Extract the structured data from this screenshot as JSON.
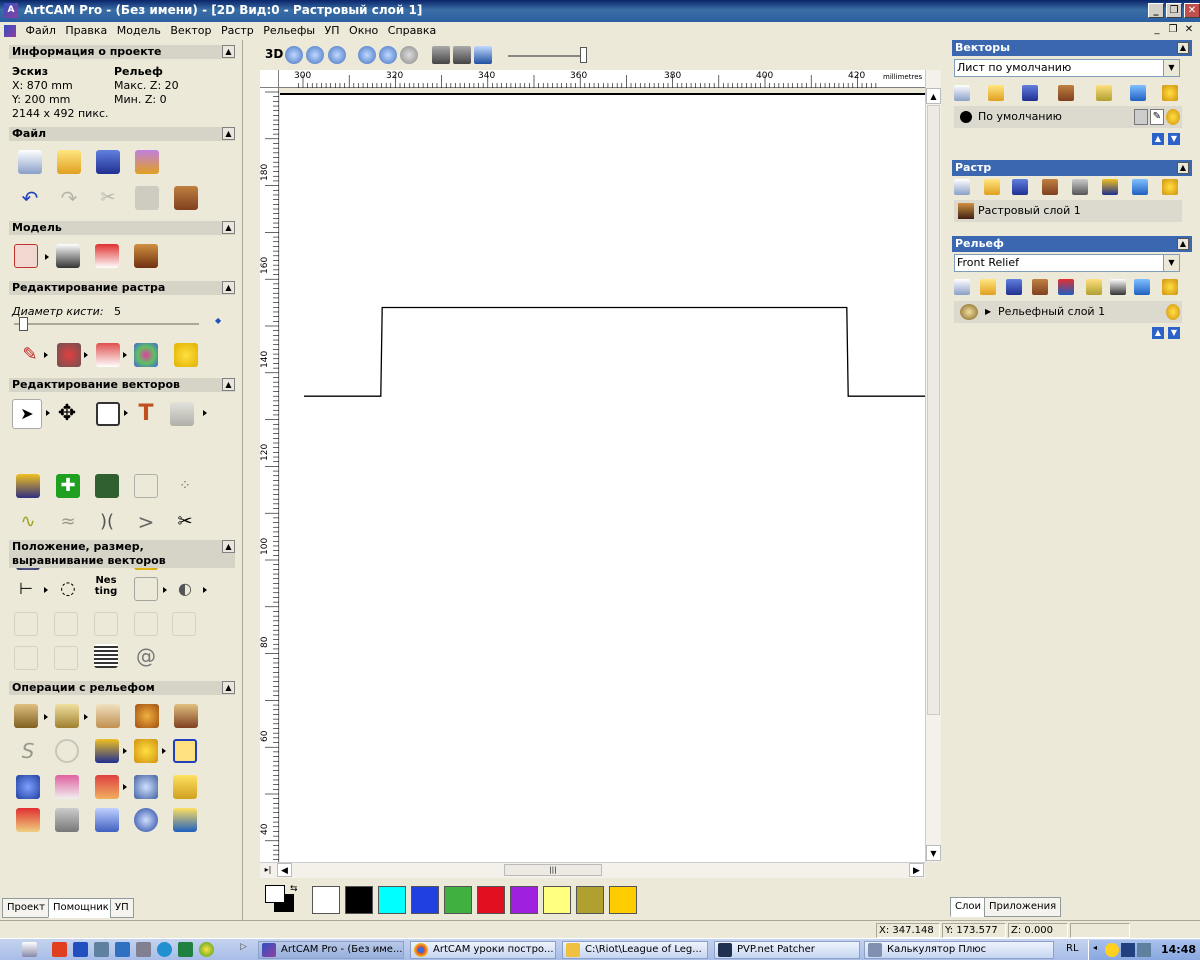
{
  "window": {
    "title": "ArtCAM Pro - (Без имени) - [2D Вид:0 - Растровый слой 1]"
  },
  "menu": [
    "Файл",
    "Правка",
    "Модель",
    "Вектор",
    "Растр",
    "Рельефы",
    "УП",
    "Окно",
    "Справка"
  ],
  "project_info": {
    "header": "Информация о проекте",
    "sketch_label": "Эскиз",
    "relief_label": "Рельеф",
    "x": "X: 870 mm",
    "y": "Y: 200 mm",
    "pixels": "2144 x 492 пикс.",
    "max_z": "Макс. Z: 20",
    "min_z": "Мин. Z: 0"
  },
  "sections": {
    "file": "Файл",
    "model": "Модель",
    "raster_edit": "Редактирование растра",
    "vector_edit": "Редактирование векторов",
    "position": "Положение, размер, выравнивание векторов",
    "relief_ops": "Операции с рельефом"
  },
  "brush": {
    "label": "Диаметр кисти:",
    "value": "5"
  },
  "view_toolbar": {
    "btn3d": "3D"
  },
  "ruler": {
    "h_ticks": [
      "300",
      "320",
      "340",
      "360",
      "380",
      "400",
      "420"
    ],
    "units": "millimetres",
    "v_ticks": [
      "180",
      "160",
      "140",
      "120",
      "100",
      "80",
      "60",
      "40"
    ]
  },
  "drawing": {
    "profile_y_low": 122,
    "profile_y_high": 141,
    "profile_x_start": 300,
    "profile_x_rise": 317,
    "profile_x_fall": 418,
    "profile_x_end": 436
  },
  "palette": {
    "colors": [
      "#ffffff",
      "#000000",
      "#00ffff",
      "#2040e0",
      "#40b040",
      "#e01020",
      "#a020e0",
      "#ffff80",
      "#b0a030",
      "#ffcc00"
    ]
  },
  "vectors_panel": {
    "header": "Векторы",
    "sheet": "Лист по умолчанию",
    "layer": "По умолчанию"
  },
  "raster_panel": {
    "header": "Растр",
    "layer": "Растровый слой 1"
  },
  "relief_panel": {
    "header": "Рельеф",
    "relief": "Front Relief",
    "layer": "Рельефный слой 1"
  },
  "left_tabs": [
    "Проект",
    "Помощник",
    "УП"
  ],
  "right_tabs": [
    "Слои",
    "Приложения"
  ],
  "status": {
    "x": "X: 347.148",
    "y": "Y: 173.577",
    "z": "Z: 0.000"
  },
  "taskbar": {
    "items": [
      "ArtCAM Pro - (Без име...",
      "ArtCAM уроки постро...",
      "C:\\Riot\\League of Leg...",
      "PVP.net Patcher",
      "Калькулятор Плюс"
    ],
    "lang": "RL",
    "time": "14:48"
  }
}
